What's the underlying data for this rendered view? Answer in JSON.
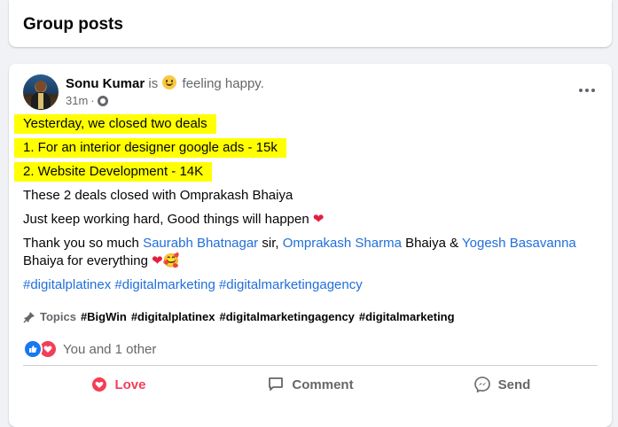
{
  "header": {
    "title": "Group posts"
  },
  "post": {
    "author": "Sonu Kumar",
    "is_text": "is",
    "feeling": "feeling happy.",
    "time": "31m",
    "lines": {
      "l1": "Yesterday, we closed two deals",
      "l2": "1. For an interior designer google ads - 15k",
      "l3": "2. Website Development -  14K",
      "l4": "These 2 deals closed with Omprakash Bhaiya",
      "l5": "Just keep working hard, Good things will happen",
      "l6_a": "Thank you so much ",
      "l6_link1": "Saurabh Bhatnagar",
      "l6_b": " sir, ",
      "l6_link2": "Omprakash Sharma",
      "l6_c": " Bhaiya & ",
      "l6_link3": "Yogesh Basavanna",
      "l6_d": "Bhaiya for everything",
      "hashtags": "#digitalplatinex #digitalmarketing #digitalmarketingagency"
    },
    "topics": {
      "label": "Topics",
      "items": [
        "#BigWin",
        "#digitalplatinex",
        "#digitalmarketingagency",
        "#digitalmarketing"
      ]
    },
    "reactions_text": "You and 1 other",
    "actions": {
      "love": "Love",
      "comment": "Comment",
      "send": "Send"
    }
  },
  "colors": {
    "link": "#216fdb",
    "love": "#f33e58",
    "highlight": "#ffff00",
    "like": "#1877f2"
  }
}
